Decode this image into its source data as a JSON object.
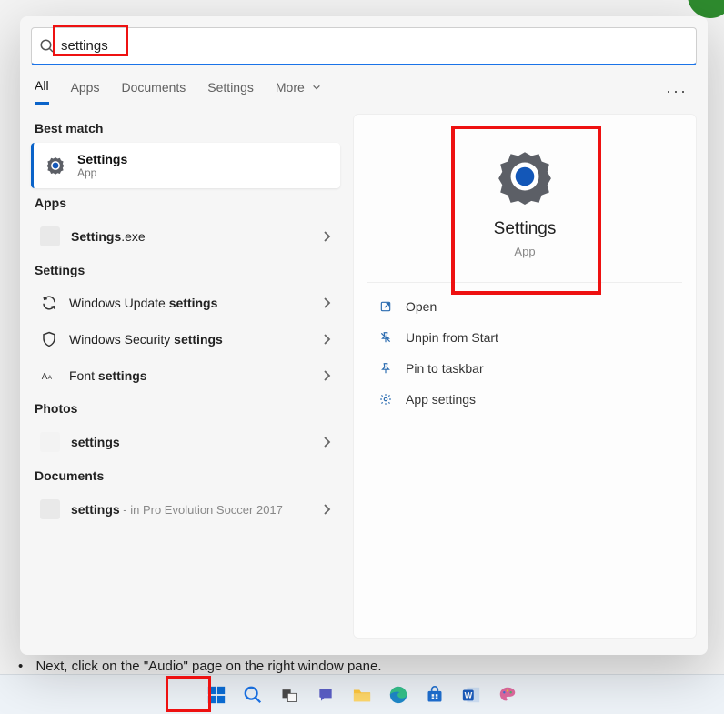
{
  "search": {
    "value": "settings"
  },
  "tabs": {
    "all": "All",
    "apps": "Apps",
    "documents": "Documents",
    "settings": "Settings",
    "more": "More"
  },
  "left": {
    "best_match_header": "Best match",
    "best_match": {
      "title": "Settings",
      "sub": "App"
    },
    "apps_header": "Apps",
    "apps": {
      "settings_exe_pre": "Settings",
      "settings_exe_suf": ".exe"
    },
    "settings_header": "Settings",
    "settings_items": {
      "update_pre": "Windows Update ",
      "update_b": "settings",
      "security_pre": "Windows Security ",
      "security_b": "settings",
      "font_pre": "Font ",
      "font_b": "settings"
    },
    "photos_header": "Photos",
    "photos": {
      "item": "settings"
    },
    "documents_header": "Documents",
    "docs": {
      "name": "settings",
      "sub": " - in Pro Evolution Soccer 2017"
    }
  },
  "preview": {
    "title": "Settings",
    "sub": "App"
  },
  "actions": {
    "open": "Open",
    "unpin": "Unpin from Start",
    "pin_taskbar": "Pin to taskbar",
    "app_settings": "App settings"
  },
  "behind": "Next, click on the \"Audio\" page on the right window pane."
}
